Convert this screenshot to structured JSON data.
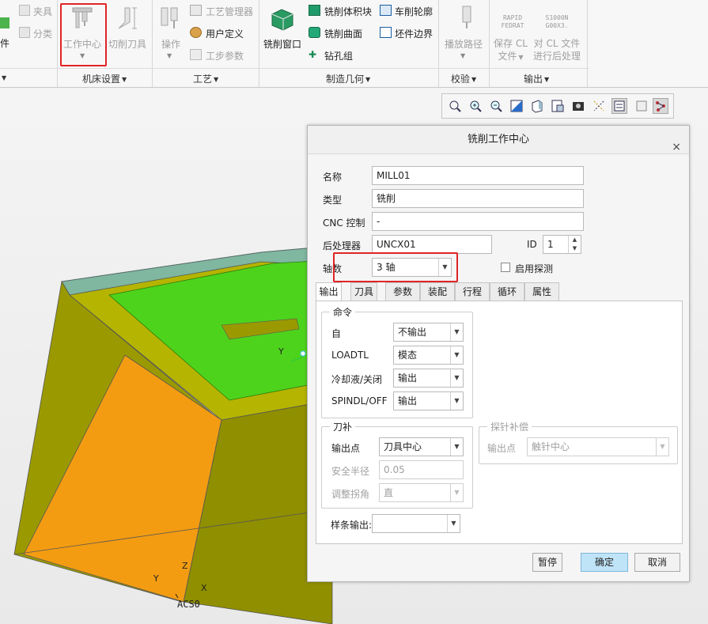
{
  "ribbon": {
    "left_partial": {
      "fixture": "夹具",
      "divide": "分类",
      "part_fragment": "件"
    },
    "machine_setup": {
      "work_center": "工作中心",
      "cutting_tool": "切削刀具",
      "group_label": "机床设置"
    },
    "process": {
      "operation": "操作",
      "process_manager": "工艺管理器",
      "user_defined": "用户定义",
      "step_params": "工步参数",
      "group_label": "工艺"
    },
    "mfg_geometry": {
      "mill_window": "铣削窗口",
      "mill_volume": "铣削体积块",
      "mill_surface": "铣削曲面",
      "drill_group": "钻孔组",
      "turn_profile": "车削轮廓",
      "stock_boundary": "坯件边界",
      "group_label": "制造几何"
    },
    "verify": {
      "play_path": "播放路径",
      "group_label": "校验"
    },
    "output": {
      "save_cl": "保存 CL\n文件",
      "post_process": "对 CL 文件\n进行后处理",
      "save_cl_line1": "保存 CL",
      "save_cl_line2": "文件",
      "post_line1": "对 CL 文件",
      "post_line2": "进行后处理",
      "rapid_icon_line1": "RAPID",
      "rapid_icon_line2": "FEDRAT",
      "spindle_icon_line1": "S1000N",
      "spindle_icon_line2": "G00X3.",
      "group_label": "输出"
    }
  },
  "viewport": {
    "csys_label": "ACS0",
    "axis_x": "X",
    "axis_y": "Y",
    "axis_z": "Z",
    "colors": {
      "orange": "#f39c12",
      "olive": "#8f8f00",
      "green": "#4ed31c",
      "teal": "#7fb7a0"
    }
  },
  "view_toolbar": {
    "icons": [
      "zoom-fit-icon",
      "zoom-in-icon",
      "zoom-out-icon",
      "shading-icon",
      "view-orient-icon",
      "saved-views-icon",
      "appearance-icon",
      "datum-display-icon",
      "spin-center-icon",
      "annotation-icon",
      "tree-toggle-icon"
    ]
  },
  "dialog": {
    "title": "铣削工作中心",
    "close": "×",
    "name_label": "名称",
    "name_value": "MILL01",
    "type_label": "类型",
    "type_value": "铣削",
    "cnc_label": "CNC 控制",
    "cnc_value": "-",
    "post_label": "后处理器",
    "post_value": "UNCX01",
    "id_label": "ID",
    "id_value": "1",
    "axes_label": "轴数",
    "axes_value": "3 轴",
    "probe_label": "启用探测",
    "tabs": [
      "输出",
      "刀具",
      "参数",
      "装配",
      "行程",
      "循环",
      "属性"
    ],
    "commands": {
      "title": "命令",
      "rows": [
        {
          "label": "自",
          "value": "不输出"
        },
        {
          "label": "LOADTL",
          "value": "模态"
        },
        {
          "label": "冷却液/关闭",
          "value": "输出"
        },
        {
          "label": "SPINDL/OFF",
          "value": "输出"
        }
      ]
    },
    "cutter_comp": {
      "title": "刀补",
      "output_point_label": "输出点",
      "output_point_value": "刀具中心",
      "safe_radius_label": "安全半径",
      "safe_radius_value": "0.05",
      "adjust_corner_label": "调整拐角",
      "adjust_corner_value": "直"
    },
    "probe_comp": {
      "title": "探针补偿",
      "output_point_label": "输出点",
      "output_point_value": "触针中心"
    },
    "spline_output_label": "样条输出:",
    "spline_output_value": "",
    "buttons": {
      "pause": "暂停",
      "ok": "确定",
      "cancel": "取消"
    }
  }
}
